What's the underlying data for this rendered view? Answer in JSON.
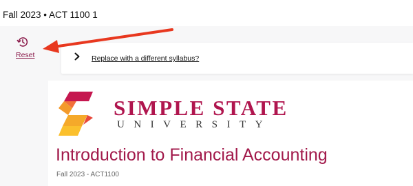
{
  "header": {
    "course_label": "Fall 2023 • ACT 1100 1"
  },
  "toolbar": {
    "reset_label": "Reset"
  },
  "replace_panel": {
    "link_text": "Replace with a different syllabus?"
  },
  "syllabus": {
    "university_name": "SIMPLE STATE",
    "university_sub": "UNIVERSITY",
    "course_title": "Introduction to Financial Accounting",
    "course_subtitle": "Fall 2023 - ACT1100"
  },
  "colors": {
    "accent": "#a21a4b",
    "arrow": "#e8381f"
  },
  "icons": {
    "reset": "history-icon",
    "expand": "chevron-right-icon"
  }
}
